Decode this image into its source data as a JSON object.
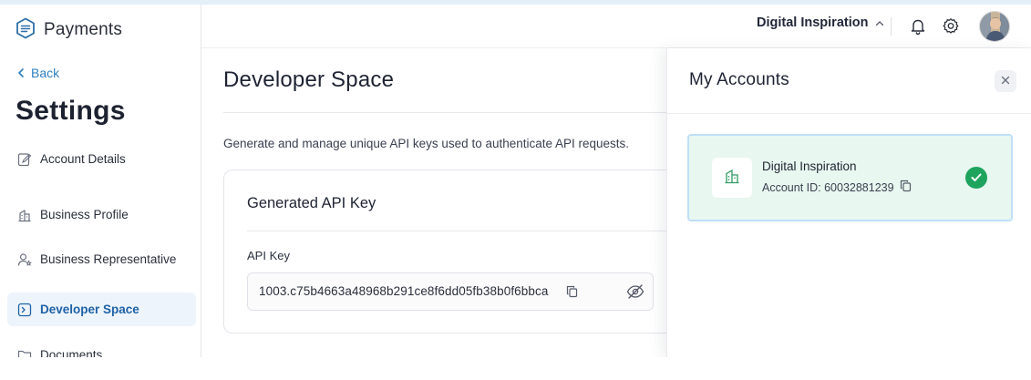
{
  "brand": {
    "name": "Payments"
  },
  "sidebar": {
    "back_label": "Back",
    "title": "Settings",
    "items": [
      {
        "label": "Account Details",
        "icon": "edit-icon",
        "active": false
      },
      {
        "label": "Business Profile",
        "icon": "building-icon",
        "active": false
      },
      {
        "label": "Business Representative",
        "icon": "user-star-icon",
        "active": false
      },
      {
        "label": "Developer Space",
        "icon": "terminal-icon",
        "active": true
      },
      {
        "label": "Documents",
        "icon": "folder-icon",
        "active": false
      }
    ]
  },
  "header": {
    "org_name": "Digital Inspiration",
    "icons": [
      "chevron-up-icon",
      "bell-icon",
      "gear-icon",
      "avatar"
    ]
  },
  "main": {
    "title": "Developer Space",
    "description": "Generate and manage unique API keys used to authenticate API requests.",
    "card": {
      "title": "Generated API Key",
      "field_label": "API Key",
      "api_key": "1003.c75b4663a48968b291ce8f6dd05fb38b0f6bbca"
    }
  },
  "panel": {
    "title": "My Accounts",
    "account": {
      "name": "Digital Inspiration",
      "id_label": "Account ID: 60032881239",
      "selected": true
    }
  },
  "colors": {
    "accent": "#2e7fbf",
    "active_nav_bg": "#edf4fc",
    "selected_card_bg": "#e8f7f0",
    "check_green": "#1fa45e"
  }
}
